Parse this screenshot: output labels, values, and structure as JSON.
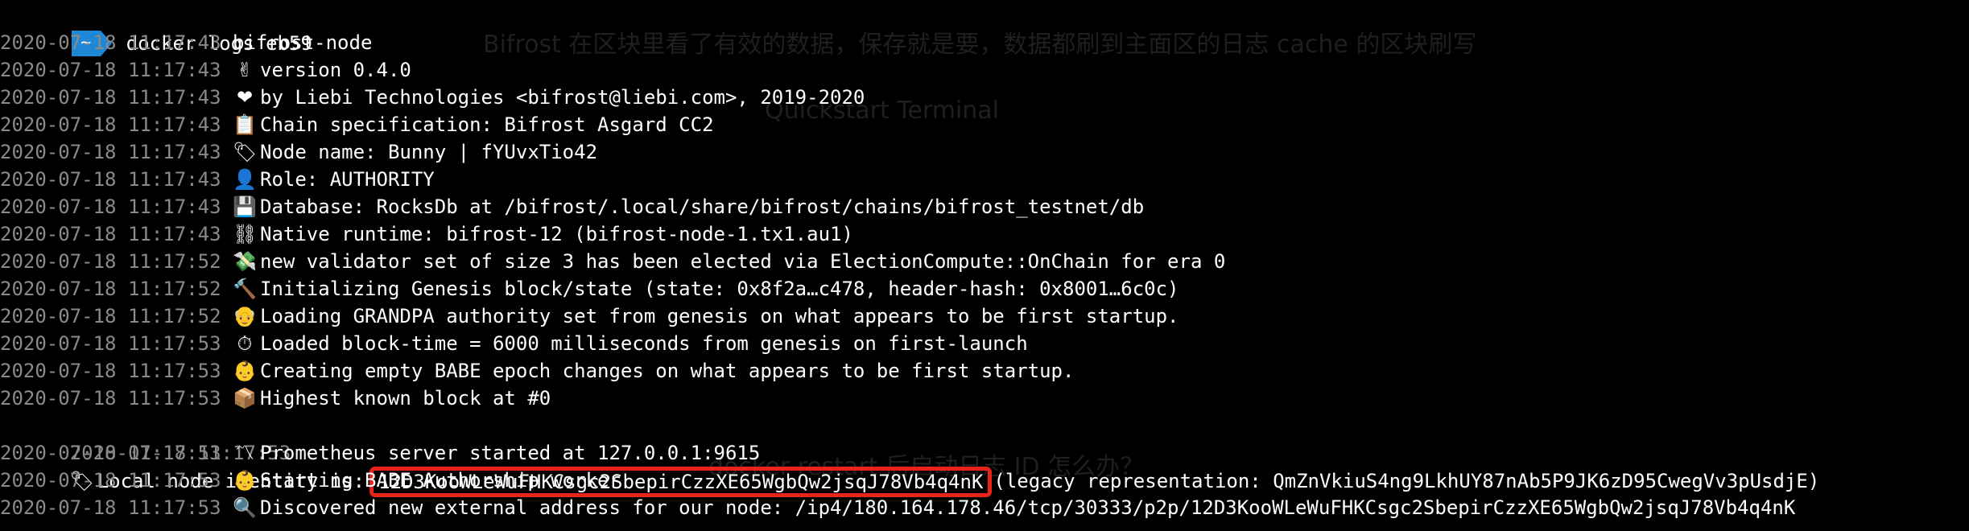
{
  "prompt": {
    "tag": "~",
    "command": "docker logs eb59",
    "tag_color": "#1e88d6"
  },
  "background_watermarks": [
    "Bifrost 在区块里看了有效的数据，保存就是要，数据都刷到主面区的日志 cache 的区块刷写",
    "Quickstart Terminal",
    "docker restart 后启动日志 ID 怎么办？"
  ],
  "log_lines": [
    {
      "ts": "2020-07-18 11:17:43",
      "icon": "",
      "icon_name": "",
      "text": "bifrost-node"
    },
    {
      "ts": "2020-07-18 11:17:43",
      "icon": "✌",
      "icon_name": "victory-hand-icon",
      "text": "version 0.4.0"
    },
    {
      "ts": "2020-07-18 11:17:43",
      "icon": "❤",
      "icon_name": "red-heart-icon",
      "text": "by Liebi Technologies <bifrost@liebi.com>, 2019-2020"
    },
    {
      "ts": "2020-07-18 11:17:43",
      "icon": "📋",
      "icon_name": "clipboard-icon",
      "text": "Chain specification: Bifrost Asgard CC2"
    },
    {
      "ts": "2020-07-18 11:17:43",
      "icon": "🏷",
      "icon_name": "label-tag-icon",
      "text": "Node name: Bunny | fYUvxTio42"
    },
    {
      "ts": "2020-07-18 11:17:43",
      "icon": "👤",
      "icon_name": "user-silhouette-icon",
      "text": "Role: AUTHORITY"
    },
    {
      "ts": "2020-07-18 11:17:43",
      "icon": "💾",
      "icon_name": "floppy-disk-icon",
      "text": "Database: RocksDb at /bifrost/.local/share/bifrost/chains/bifrost_testnet/db"
    },
    {
      "ts": "2020-07-18 11:17:43",
      "icon": "⛓",
      "icon_name": "chains-icon",
      "text": "Native runtime: bifrost-12 (bifrost-node-1.tx1.au1)"
    },
    {
      "ts": "2020-07-18 11:17:52",
      "icon": "💸",
      "icon_name": "money-with-wings-icon",
      "text": "new validator set of size 3 has been elected via ElectionCompute::OnChain for era 0"
    },
    {
      "ts": "2020-07-18 11:17:52",
      "icon": "🔨",
      "icon_name": "hammer-icon",
      "text": "Initializing Genesis block/state (state: 0x8f2a…c478, header-hash: 0x8001…6c0c)"
    },
    {
      "ts": "2020-07-18 11:17:52",
      "icon": "👴",
      "icon_name": "old-man-icon",
      "text": "Loading GRANDPA authority set from genesis on what appears to be first startup."
    },
    {
      "ts": "2020-07-18 11:17:53",
      "icon": "⏱",
      "icon_name": "stopwatch-icon",
      "text": "Loaded block-time = 6000 milliseconds from genesis on first-launch"
    },
    {
      "ts": "2020-07-18 11:17:53",
      "icon": "👶",
      "icon_name": "baby-icon",
      "text": "Creating empty BABE epoch changes on what appears to be first startup."
    },
    {
      "ts": "2020-07-18 11:17:53",
      "icon": "📦",
      "icon_name": "package-icon",
      "text": "Highest known block at #0"
    }
  ],
  "identity_line": {
    "ts": "2020-07-18 11:17:53",
    "icon": "🏷",
    "icon_name": "label-tag-icon",
    "prefix": "Local node identity is:",
    "identity": "12D3KooWLeWuFHKCsgc2SbepirCzzXE65WgbQw2jsqJ78Vb4q4nK",
    "suffix": "(legacy representation: QmZnVkiuS4ng9LkhUY87nAb5P9JK6zD95CwegVv3pUsdjE)",
    "highlight_color": "#e8231a"
  },
  "log_lines_after": [
    {
      "ts": "2020-07-18 11:17:53",
      "icon": "〽",
      "icon_name": "part-alternation-mark-icon",
      "text": "Prometheus server started at 127.0.0.1:9615"
    },
    {
      "ts": "2020-07-18 11:17:53",
      "icon": "👶",
      "icon_name": "baby-icon",
      "text": "Starting BABE Authorship worker"
    },
    {
      "ts": "2020-07-18 11:17:53",
      "icon": "🔍",
      "icon_name": "magnifying-glass-icon",
      "text": "Discovered new external address for our node: /ip4/180.164.178.46/tcp/30333/p2p/12D3KooWLeWuFHKCsgc2SbepirCzzXE65WgbQw2jsqJ78Vb4q4nK"
    }
  ],
  "colors": {
    "background": "#000000",
    "timestamp": "#8a8a8a",
    "text": "#ffffff"
  }
}
